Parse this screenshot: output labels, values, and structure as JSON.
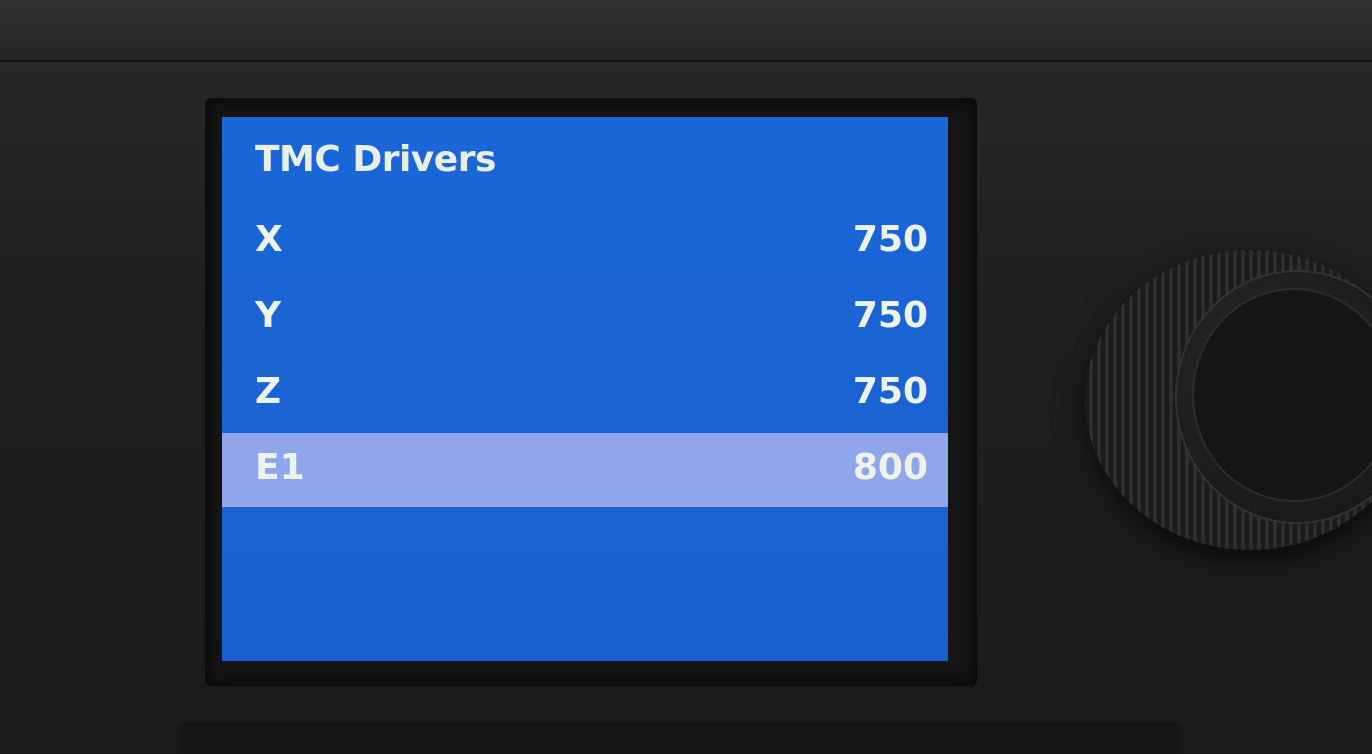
{
  "screen": {
    "title": "TMC Drivers",
    "rows": [
      {
        "label": "X",
        "value": "750",
        "selected": false
      },
      {
        "label": "Y",
        "value": "750",
        "selected": false
      },
      {
        "label": "Z",
        "value": "750",
        "selected": false
      },
      {
        "label": "E1",
        "value": "800",
        "selected": true
      }
    ]
  },
  "colors": {
    "screen_background": "#1a63d3",
    "selection_highlight": "#8fa6ec",
    "text": "#eef3ea",
    "device_body": "#1f1f21"
  },
  "icons": {
    "knob": "rotary-encoder-knob"
  }
}
